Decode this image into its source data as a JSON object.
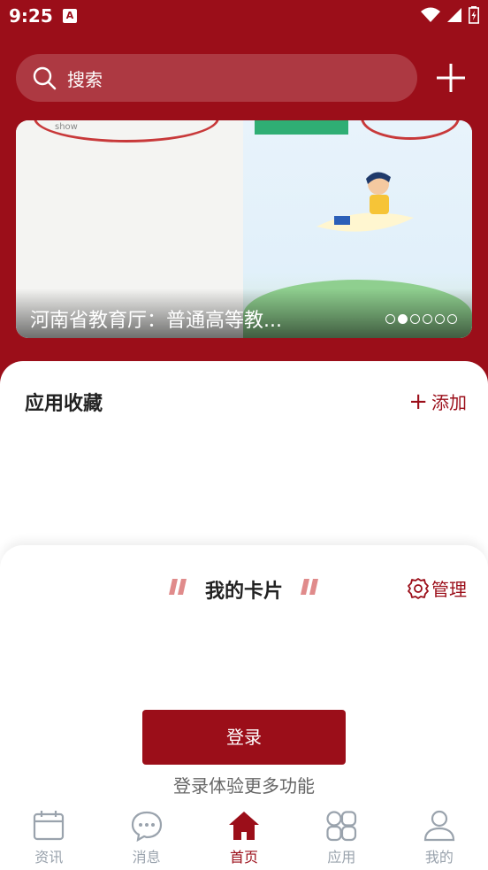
{
  "status_bar": {
    "time": "9:25",
    "app_icon_letter": "A"
  },
  "search": {
    "placeholder": "搜索"
  },
  "banner": {
    "caption": "河南省教育厅：普通高等教...",
    "small_text": "show",
    "dots": 6,
    "active_dot": 1
  },
  "favorites": {
    "title": "应用收藏",
    "add_label": "添加"
  },
  "cards": {
    "title": "我的卡片",
    "manage_label": "管理"
  },
  "login": {
    "button_label": "登录",
    "hint": "登录体验更多功能"
  },
  "tabbar": {
    "items": [
      {
        "label": "资讯",
        "icon": "calendar-icon",
        "active": false
      },
      {
        "label": "消息",
        "icon": "chat-icon",
        "active": false
      },
      {
        "label": "首页",
        "icon": "home-icon",
        "active": true
      },
      {
        "label": "应用",
        "icon": "apps-icon",
        "active": false
      },
      {
        "label": "我的",
        "icon": "user-icon",
        "active": false
      }
    ]
  },
  "colors": {
    "brand": "#9b0e19",
    "inactive_tab": "#9aa3ad"
  }
}
